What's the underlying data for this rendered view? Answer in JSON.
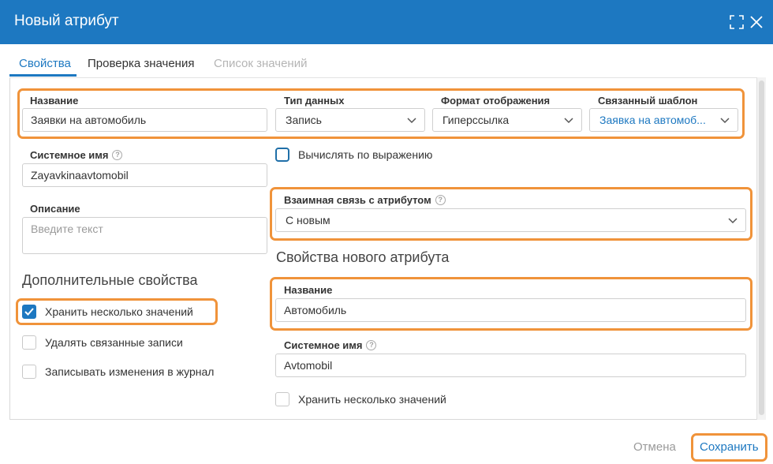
{
  "dialog": {
    "title": "Новый атрибут"
  },
  "tabs": [
    {
      "label": "Свойства",
      "state": "active"
    },
    {
      "label": "Проверка значения",
      "state": "normal"
    },
    {
      "label": "Список значений",
      "state": "disabled"
    }
  ],
  "left": {
    "name": {
      "label": "Название",
      "value": "Заявки на автомобиль"
    },
    "system_name": {
      "label": "Системное имя",
      "value": "Zayavkinaavtomobil"
    },
    "description": {
      "label": "Описание",
      "placeholder": "Введите текст"
    },
    "additional": {
      "title": "Дополнительные свойства",
      "options": [
        {
          "label": "Хранить несколько значений",
          "checked": true
        },
        {
          "label": "Удалять связанные записи",
          "checked": false
        },
        {
          "label": "Записывать изменения в журнал",
          "checked": false
        }
      ]
    }
  },
  "right": {
    "data_type": {
      "label": "Тип данных",
      "value": "Запись"
    },
    "display_format": {
      "label": "Формат отображения",
      "value": "Гиперссылка"
    },
    "linked_template": {
      "label": "Связанный шаблон",
      "value": "Заявка на автомоб..."
    },
    "compute_by_expression": {
      "label": "Вычислять по выражению",
      "checked": false
    },
    "mutual_link": {
      "label": "Взаимная связь с атрибутом",
      "value": "С новым"
    },
    "new_attribute": {
      "title": "Свойства нового атрибута",
      "name": {
        "label": "Название",
        "value": "Автомобиль"
      },
      "system_name": {
        "label": "Системное имя",
        "value": "Avtomobil"
      },
      "multiple_values": {
        "label": "Хранить несколько значений",
        "checked": false
      }
    }
  },
  "footer": {
    "cancel_label": "Отмена",
    "save_label": "Сохранить"
  },
  "colors": {
    "header": "#1d78c1",
    "accent": "#1d78c1",
    "highlight": "#f0933a",
    "disabled_text": "#b5b5b5"
  },
  "icons": {
    "maximize": "maximize-icon",
    "close": "close-icon",
    "dropdown": "chevron-down-icon",
    "help": "help-circle-icon",
    "check": "checkmark-icon"
  }
}
